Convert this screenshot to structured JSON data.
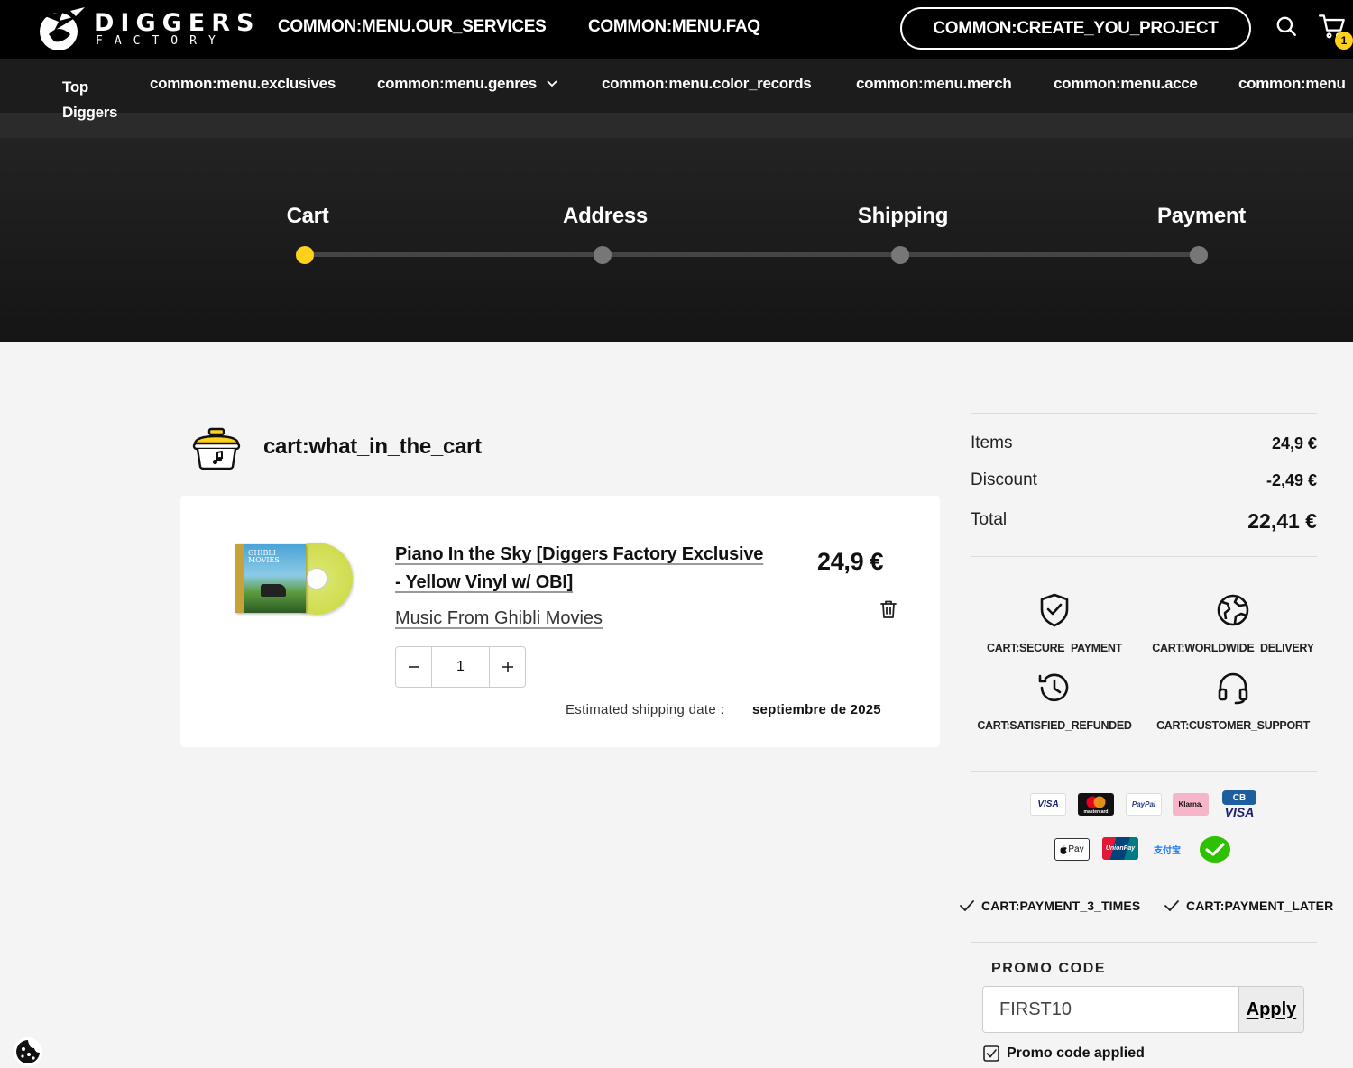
{
  "header": {
    "logo_word": "DIGGERS",
    "logo_sub": "FACTORY",
    "nav": [
      {
        "label": "COMMON:MENU.OUR_SERVICES"
      },
      {
        "label": "COMMON:MENU.FAQ"
      }
    ],
    "create_project_label": "COMMON:CREATE_YOU_PROJECT",
    "cart_count": "1",
    "accent_color": "#ffd11a"
  },
  "subnav": {
    "items": [
      {
        "label": "Top Diggers"
      },
      {
        "label": "common:menu.exclusives"
      },
      {
        "label": "common:menu.genres"
      },
      {
        "label": "common:menu.color_records"
      },
      {
        "label": "common:menu.merch"
      },
      {
        "label": "common:menu.acce"
      },
      {
        "label": "common:menu"
      }
    ]
  },
  "steps": [
    {
      "label": "Cart",
      "active": true
    },
    {
      "label": "Address",
      "active": false
    },
    {
      "label": "Shipping",
      "active": false
    },
    {
      "label": "Payment",
      "active": false
    }
  ],
  "cart": {
    "title": "cart:what_in_the_cart",
    "item": {
      "title": "Piano In the Sky [Diggers Factory Exclusive - Yellow Vinyl w/ OBI]",
      "artist": "Music From Ghibli Movies",
      "price": "24,9 €",
      "quantity": "1",
      "cover_text": "GHIBLI MOVIES",
      "shipping_label": "Estimated shipping date :",
      "shipping_date": "septiembre de 2025"
    }
  },
  "summary": {
    "items_label": "Items",
    "items_value": "24,9 €",
    "discount_label": "Discount",
    "discount_value": "-2,49 €",
    "total_label": "Total",
    "total_value": "22,41 €"
  },
  "features": [
    {
      "label": "CART:SECURE_PAYMENT",
      "icon": "shield-check-icon"
    },
    {
      "label": "CART:WORLDWIDE_DELIVERY",
      "icon": "globe-icon"
    },
    {
      "label": "CART:SATISFIED_REFUNDED",
      "icon": "history-icon"
    },
    {
      "label": "CART:CUSTOMER_SUPPORT",
      "icon": "headset-icon"
    }
  ],
  "payment_methods": {
    "visa": "VISA",
    "mastercard": "mastercard",
    "paypal": "PayPal",
    "klarna": "Klarna.",
    "cb": "CB",
    "cb_visa": "VISA",
    "applepay": "Pay",
    "unionpay": "UnionPay",
    "alipay": "支付宝",
    "wechat": "wechat"
  },
  "payment_options": {
    "three_times": "CART:PAYMENT_3_TIMES",
    "later": "CART:PAYMENT_LATER"
  },
  "promo": {
    "label": "PROMO CODE",
    "value": "FIRST10",
    "apply_label": "Apply",
    "applied_label": "Promo code applied"
  }
}
